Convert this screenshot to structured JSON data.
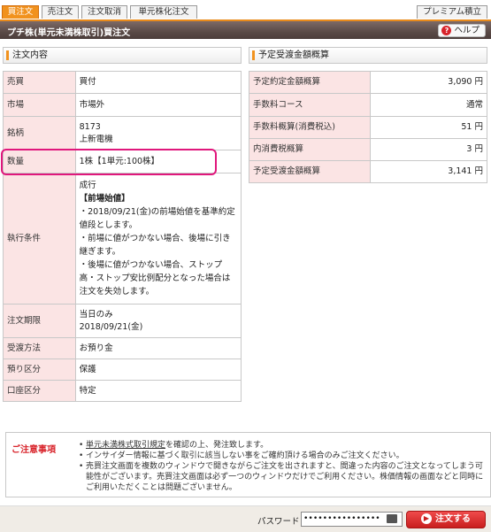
{
  "tabs": [
    {
      "label": "買注文"
    },
    {
      "label": "売注文"
    },
    {
      "label": "注文取消"
    },
    {
      "label": "単元株化注文"
    }
  ],
  "premium_tab": "プレミアム積立",
  "title": "プチ株(単元未満株取引)買注文",
  "help_label": "ヘルプ",
  "order_section": {
    "heading": "注文内容",
    "rows": {
      "side": {
        "label": "売買",
        "value": "買付"
      },
      "market": {
        "label": "市場",
        "value": "市場外"
      },
      "issue": {
        "label": "銘柄",
        "code": "8173",
        "name": "上新電機"
      },
      "qty": {
        "label": "数量",
        "value": "1株【1単元:100株】"
      },
      "condition": {
        "label": "執行条件",
        "line1": "成行",
        "line2": "【前場始値】",
        "line3": "・2018/09/21(金)の前場始値を基準約定値段とします。",
        "line4": "・前場に値がつかない場合、後場に引き継ぎます。",
        "line5": "・後場に値がつかない場合、ストップ高・ストップ安比例配分となった場合は注文を失効します。"
      },
      "period": {
        "label": "注文期限",
        "line1": "当日のみ",
        "line2": "2018/09/21(金)"
      },
      "receive": {
        "label": "受渡方法",
        "value": "お預り金"
      },
      "custody": {
        "label": "預り区分",
        "value": "保護"
      },
      "account": {
        "label": "口座区分",
        "value": "特定"
      }
    }
  },
  "estimate_section": {
    "heading": "予定受渡金額概算",
    "rows": [
      {
        "label": "予定約定金額概算",
        "value": "3,090 円"
      },
      {
        "label": "手数料コース",
        "value": "通常"
      },
      {
        "label": "手数料概算(消費税込)",
        "value": "51 円"
      },
      {
        "label": "内消費税概算",
        "value": "3 円"
      },
      {
        "label": "予定受渡金額概算",
        "value": "3,141 円"
      }
    ]
  },
  "notes": {
    "label": "ご注意事項",
    "item1_link": "単元未満株式取引規定",
    "item1_rest": "を確認の上、発注致します。",
    "item2": "インサイダー情報に基づく取引に該当しない事をご確約頂ける場合のみご注文ください。",
    "item3": "売買注文画面を複数のウィンドウで開きながらご注文を出されますと、間違った内容のご注文となってしまう可能性がございます。売買注文画面は必ず一つのウィンドウだけでご利用ください。株価情報の画面などと同時にご利用いただくことは問題ございません。"
  },
  "password_label": "パスワード",
  "password_value": "••••••••••••••••",
  "submit_label": "注文する",
  "colors": {
    "accent": "#f1921e",
    "label_bg": "#fbe4e4",
    "highlight": "#e0177c",
    "submit": "#d8232a"
  }
}
